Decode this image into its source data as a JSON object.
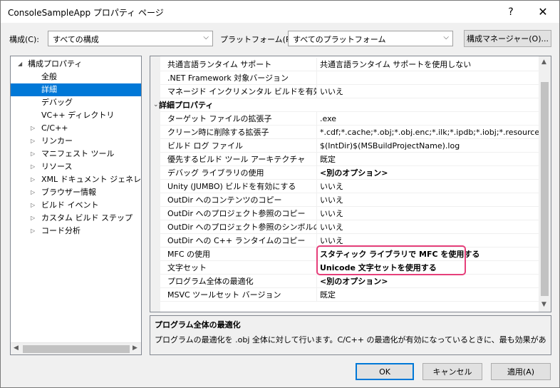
{
  "window": {
    "title": "ConsoleSampleApp プロパティ ページ",
    "help_label": "?",
    "close_label": "✕"
  },
  "toolbar": {
    "config_label": "構成(C):",
    "config_value": "すべての構成",
    "platform_label": "プラットフォーム(P):",
    "platform_value": "すべてのプラットフォーム",
    "config_manager_label": "構成マネージャー(O)..."
  },
  "tree": {
    "root": "構成プロパティ",
    "items": [
      {
        "label": "全般",
        "expandable": false
      },
      {
        "label": "詳細",
        "expandable": false,
        "selected": true
      },
      {
        "label": "デバッグ",
        "expandable": false
      },
      {
        "label": "VC++ ディレクトリ",
        "expandable": false
      },
      {
        "label": "C/C++",
        "expandable": true
      },
      {
        "label": "リンカー",
        "expandable": true
      },
      {
        "label": "マニフェスト ツール",
        "expandable": true
      },
      {
        "label": "リソース",
        "expandable": true
      },
      {
        "label": "XML ドキュメント ジェネレーター",
        "expandable": true
      },
      {
        "label": "ブラウザー情報",
        "expandable": true
      },
      {
        "label": "ビルド イベント",
        "expandable": true
      },
      {
        "label": "カスタム ビルド ステップ",
        "expandable": true
      },
      {
        "label": "コード分析",
        "expandable": true
      }
    ]
  },
  "grid": {
    "rows": [
      {
        "name": "共通言語ランタイム サポート",
        "value": "共通言語ランタイム サポートを使用しない"
      },
      {
        "name": ".NET Framework 対象バージョン",
        "value": ""
      },
      {
        "name": "マネージド インクリメンタル ビルドを有効にする",
        "value": "いいえ"
      },
      {
        "category": "詳細プロパティ"
      },
      {
        "name": "ターゲット ファイルの拡張子",
        "value": ".exe"
      },
      {
        "name": "クリーン時に削除する拡張子",
        "value": "*.cdf;*.cache;*.obj;*.obj.enc;*.ilk;*.ipdb;*.iobj;*.resources;*.t"
      },
      {
        "name": "ビルド ログ ファイル",
        "value": "$(IntDir)$(MSBuildProjectName).log"
      },
      {
        "name": "優先するビルド ツール アーキテクチャ",
        "value": "既定"
      },
      {
        "name": "デバッグ ライブラリの使用",
        "value": "<別のオプション>",
        "bold": true
      },
      {
        "name": "Unity (JUMBO) ビルドを有効にする",
        "value": "いいえ"
      },
      {
        "name": "OutDir へのコンテンツのコピー",
        "value": "いいえ"
      },
      {
        "name": "OutDir へのプロジェクト参照のコピー",
        "value": "いいえ"
      },
      {
        "name": "OutDir へのプロジェクト参照のシンボルのコピー",
        "value": "いいえ"
      },
      {
        "name": "OutDir への C++ ランタイムのコピー",
        "value": "いいえ"
      },
      {
        "name": "MFC の使用",
        "value": "スタティック ライブラリで MFC を使用する",
        "bold": true
      },
      {
        "name": "文字セット",
        "value": "Unicode 文字セットを使用する",
        "bold": true
      },
      {
        "name": "プログラム全体の最適化",
        "value": "<別のオプション>",
        "bold": true
      },
      {
        "name": "MSVC ツールセット バージョン",
        "value": "既定"
      }
    ]
  },
  "description": {
    "title": "プログラム全体の最適化",
    "text": "プログラムの最適化を .obj 全体に対して行います。C/C++ の最適化が有効になっているときに、最も効果があります。"
  },
  "buttons": {
    "ok": "OK",
    "cancel": "キャンセル",
    "apply": "適用(A)"
  },
  "colors": {
    "selection": "#0078d7",
    "highlight": "#e63f7a"
  }
}
